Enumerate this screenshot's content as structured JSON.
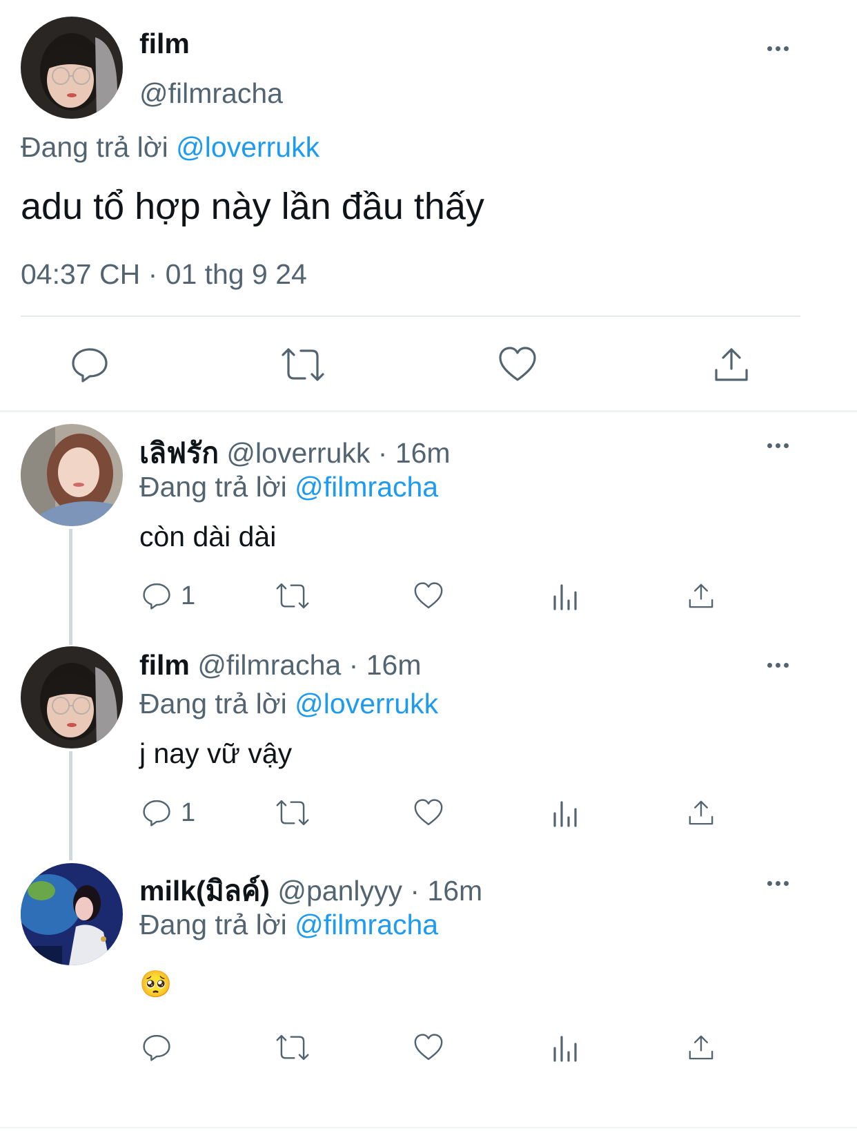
{
  "main_tweet": {
    "display_name": "film",
    "handle": "@filmracha",
    "reply_prefix": "Đang trả lời",
    "reply_to": "@loverrukk",
    "text": "adu tổ hợp này lần đầu thấy",
    "timestamp": "04:37 CH · 01 thg 9 24",
    "actions": [
      "reply-icon",
      "retweet-icon",
      "like-icon",
      "share-icon"
    ]
  },
  "replies": [
    {
      "display_name": "เลิฟรัก",
      "handle": "@loverrukk",
      "time": "· 16m",
      "reply_prefix": "Đang trả lời",
      "reply_to": "@filmracha",
      "text": "còn dài dài",
      "reply_count": "1"
    },
    {
      "display_name": "film",
      "handle": "@filmracha",
      "time": "· 16m",
      "reply_prefix": "Đang trả lời",
      "reply_to": "@loverrukk",
      "text": "j nay vữ vậy",
      "reply_count": "1"
    },
    {
      "display_name": "milk(มิลค์)",
      "handle": "@panlyyy",
      "time": "· 16m",
      "reply_prefix": "Đang trả lời",
      "reply_to": "@filmracha",
      "text": "🥺",
      "reply_count": ""
    }
  ],
  "colors": {
    "link": "#1d9bf0",
    "muted": "#536471",
    "text": "#0f1419",
    "divider": "#e6e9ec",
    "thread_line": "#cfd9de"
  }
}
